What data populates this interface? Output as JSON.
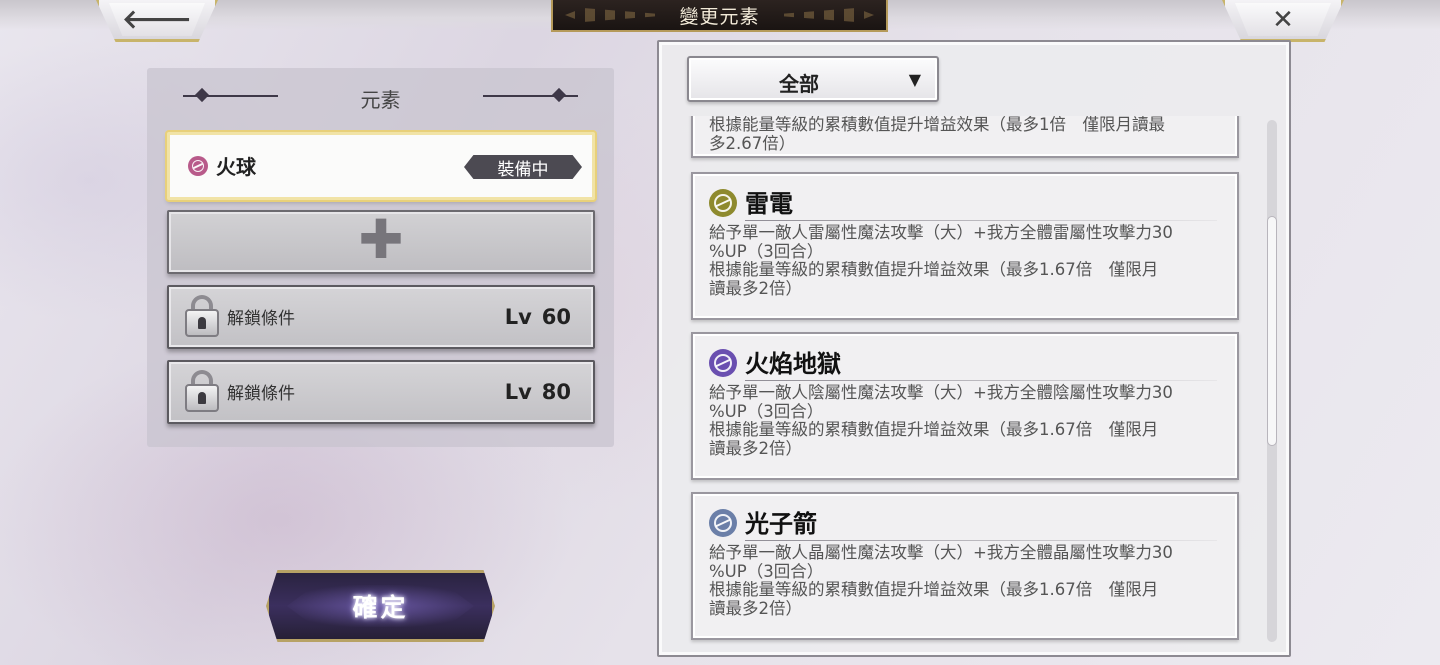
{
  "header": {
    "title": "變更元素",
    "back_glyph": "🡐",
    "close_glyph": "✕"
  },
  "left_panel": {
    "section_title": "元素",
    "equipped_slot": {
      "name": "火球",
      "badge": "裝備中",
      "icon": "dark-element-icon",
      "icon_color": "#b85a8a"
    },
    "add_slot_glyph": "✚",
    "locked_slots": [
      {
        "label": "解鎖條件",
        "lv_prefix": "Lv",
        "level": "60"
      },
      {
        "label": "解鎖條件",
        "lv_prefix": "Lv",
        "level": "80"
      }
    ],
    "confirm_label": "確定"
  },
  "right_panel": {
    "filter": {
      "selected": "全部",
      "arrow": "▼"
    },
    "partial_card": {
      "desc": "根據能量等級的累積數值提升增益效果（最多1倍　僅限月讀最\n多2.67倍）"
    },
    "cards": [
      {
        "title": "雷電",
        "icon": "thunder-element-icon",
        "icon_color": "#8e8a2e",
        "desc": "給予單一敵人雷屬性魔法攻擊（大）+我方全體雷屬性攻擊力30\n%UP（3回合）\n根據能量等級的累積數值提升增益效果（最多1.67倍　僅限月\n讀最多2倍）"
      },
      {
        "title": "火焰地獄",
        "icon": "dark-element-icon",
        "icon_color": "#6a4fb0",
        "desc": "給予單一敵人陰屬性魔法攻擊（大）+我方全體陰屬性攻擊力30\n%UP（3回合）\n根據能量等級的累積數值提升增益效果（最多1.67倍　僅限月\n讀最多2倍）"
      },
      {
        "title": "光子箭",
        "icon": "crystal-element-icon",
        "icon_color": "#6b7fa8",
        "desc": "給予單一敵人晶屬性魔法攻擊（大）+我方全體晶屬性攻擊力30\n%UP（3回合）\n根據能量等級的累積數值提升增益效果（最多1.67倍　僅限月\n讀最多2倍）"
      }
    ]
  }
}
